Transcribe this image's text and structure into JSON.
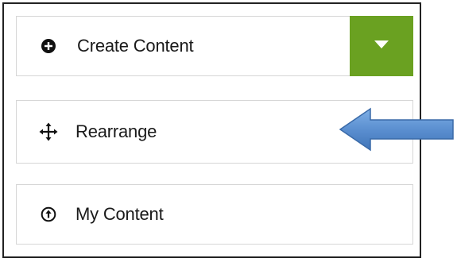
{
  "menu": {
    "create": {
      "label": "Create Content",
      "icon": "plus-circle-icon",
      "toggle_icon": "caret-down-icon",
      "toggle_color": "#6aa121"
    },
    "rearrange": {
      "label": "Rearrange",
      "icon": "move-arrows-icon"
    },
    "my_content": {
      "label": "My Content",
      "icon": "upload-circle-icon"
    }
  },
  "annotation": {
    "icon": "pointer-arrow-icon",
    "color": "#5b8fd0"
  }
}
